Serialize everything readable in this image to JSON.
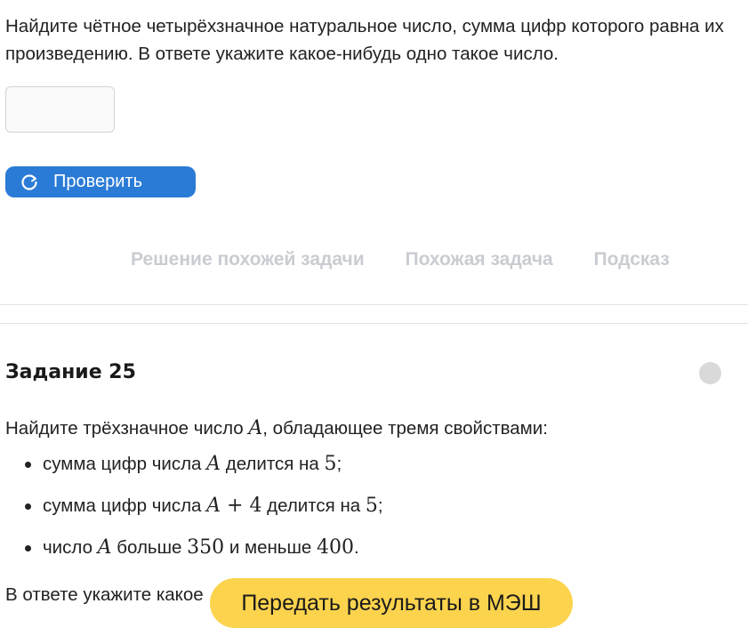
{
  "task24": {
    "text": "Найдите чётное четырёхзначное натуральное число, сумма цифр которого равна их произведению. В ответе укажите какое-нибудь одно такое число.",
    "answer_value": "",
    "check_button_label": "Проверить",
    "check_icon": "refresh-icon"
  },
  "tabs": [
    {
      "label": "Решение похожей задачи"
    },
    {
      "label": "Похожая задача"
    },
    {
      "label": "Подсказ"
    }
  ],
  "task25": {
    "title": "Задание 25",
    "intro_before": "Найдите трёхзначное число ",
    "var_A": "A",
    "intro_after": ", обладающее тремя свойствами:",
    "items": [
      {
        "pre": "сумма цифр числа ",
        "var": "A",
        "mid": " делится на ",
        "num": "5",
        "post": ";"
      },
      {
        "pre": "сумма цифр числа ",
        "var": "A",
        "op": " + 4",
        "mid": " делится на ",
        "num": "5",
        "post": ";"
      },
      {
        "pre": "число ",
        "var": "A",
        "mid": " больше ",
        "num": "350",
        "mid2": " и меньше ",
        "num2": "400",
        "post": "."
      }
    ],
    "answer_hint": "В ответе укажите какое"
  },
  "send_button_label": "Передать результаты в МЭШ",
  "colors": {
    "primary_button": "#2a7bd6",
    "send_button": "#fcd34d",
    "tab_text": "#c9ccd1",
    "status_dot": "#d9d9d9"
  }
}
